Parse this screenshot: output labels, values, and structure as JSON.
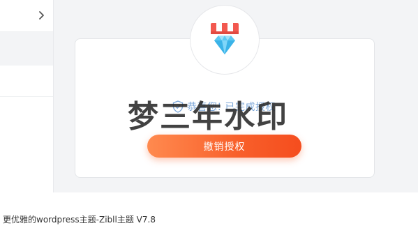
{
  "sidebar": {
    "items": [
      {
        "icon": "chevron-right-icon"
      },
      {},
      {}
    ]
  },
  "badge": {
    "icon": "diamond-vip-icon"
  },
  "status": {
    "text": "恭喜您! 已完成授权",
    "icon": "shield-check-icon"
  },
  "watermark": {
    "text": "梦三年水印"
  },
  "actions": {
    "revoke_label": "撤销授权"
  },
  "footer": {
    "text": "更优雅的wordpress主题-Zibll主题 V7.8"
  },
  "colors": {
    "accent_orange": "#f85f2a",
    "status_blue": "#7da7d8",
    "diamond_blue": "#5cc8f2",
    "awning_red": "#f2584f"
  }
}
